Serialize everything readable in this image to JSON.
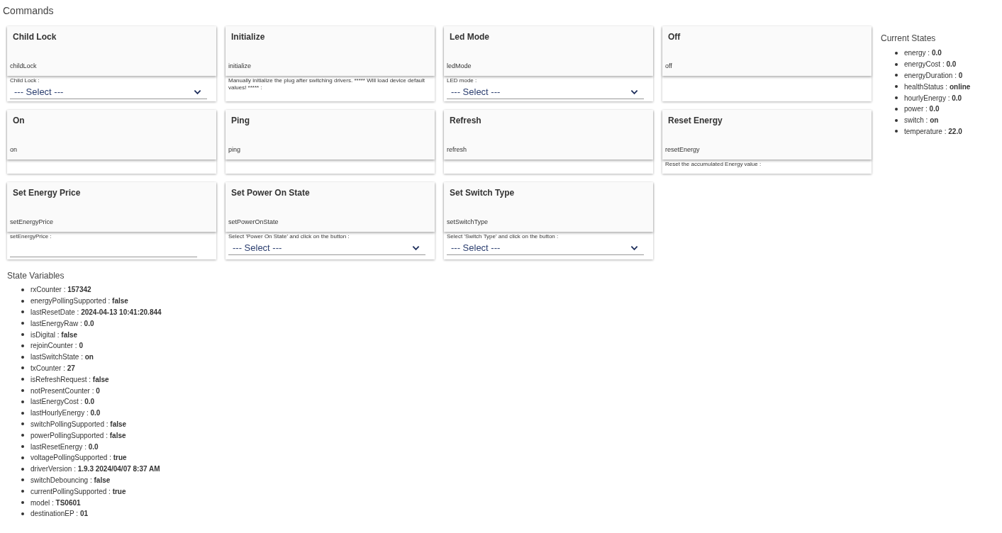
{
  "commands_title": "Commands",
  "commands": [
    {
      "title": "Child Lock",
      "command": "childLock",
      "param": {
        "kind": "select",
        "label": "Child Lock :",
        "value": "--- Select ---"
      }
    },
    {
      "title": "Initialize",
      "command": "initialize",
      "param": {
        "kind": "note",
        "label": "Manually initialize the plug after switching drivers. ***** Will load device default values! ***** :"
      }
    },
    {
      "title": "Led Mode",
      "command": "ledMode",
      "param": {
        "kind": "select",
        "label": "LED mode :",
        "value": "--- Select ---"
      }
    },
    {
      "title": "Off",
      "command": "off",
      "param": {
        "kind": "none"
      }
    },
    {
      "title": "On",
      "command": "on",
      "param": {
        "kind": "none"
      }
    },
    {
      "title": "Ping",
      "command": "ping",
      "param": {
        "kind": "none"
      }
    },
    {
      "title": "Refresh",
      "command": "refresh",
      "param": {
        "kind": "none"
      }
    },
    {
      "title": "Reset Energy",
      "command": "resetEnergy",
      "param": {
        "kind": "note",
        "label": "Reset the accumulated Energy value :"
      }
    },
    {
      "title": "Set Energy Price",
      "command": "setEnergyPrice",
      "param": {
        "kind": "text",
        "label": "setEnergyPrice :"
      }
    },
    {
      "title": "Set Power On State",
      "command": "setPowerOnState",
      "param": {
        "kind": "select",
        "label": "Select 'Power On State' and click on the button :",
        "value": "--- Select ---"
      }
    },
    {
      "title": "Set Switch Type",
      "command": "setSwitchType",
      "param": {
        "kind": "select",
        "label": "Select 'Switch Type' and click on the button :",
        "value": "--- Select ---"
      }
    }
  ],
  "current_states": {
    "title": "Current States",
    "items": [
      "energy : **0.0**",
      "energyCost : **0.0**",
      "energyDuration : **0**",
      "healthStatus : **online**",
      "hourlyEnergy : **0.0**",
      "power : **0.0**",
      "switch : **on**",
      "temperature : **22.0**"
    ]
  },
  "state_variables": {
    "title": "State Variables",
    "items": [
      "rxCounter : **157342**",
      "energyPollingSupported : **false**",
      "lastResetDate : **2024-04-13 10:41:20.844**",
      "lastEnergyRaw : **0.0**",
      "isDigital : **false**",
      "rejoinCounter : **0**",
      "lastSwitchState : **on**",
      "txCounter : **27**",
      "isRefreshRequest : **false**",
      "notPresentCounter : **0**",
      "lastEnergyCost : **0.0**",
      "lastHourlyEnergy : **0.0**",
      "switchPollingSupported : **false**",
      "powerPollingSupported : **false**",
      "lastResetEnergy : **0.0**",
      "voltagePollingSupported : **true**",
      "driverVersion : **1.9.3 2024/04/07 8:37 AM**",
      "switchDebouncing : **false**",
      "currentPollingSupported : **true**",
      "model : **TS0601**",
      "destinationEP : **01**"
    ]
  }
}
